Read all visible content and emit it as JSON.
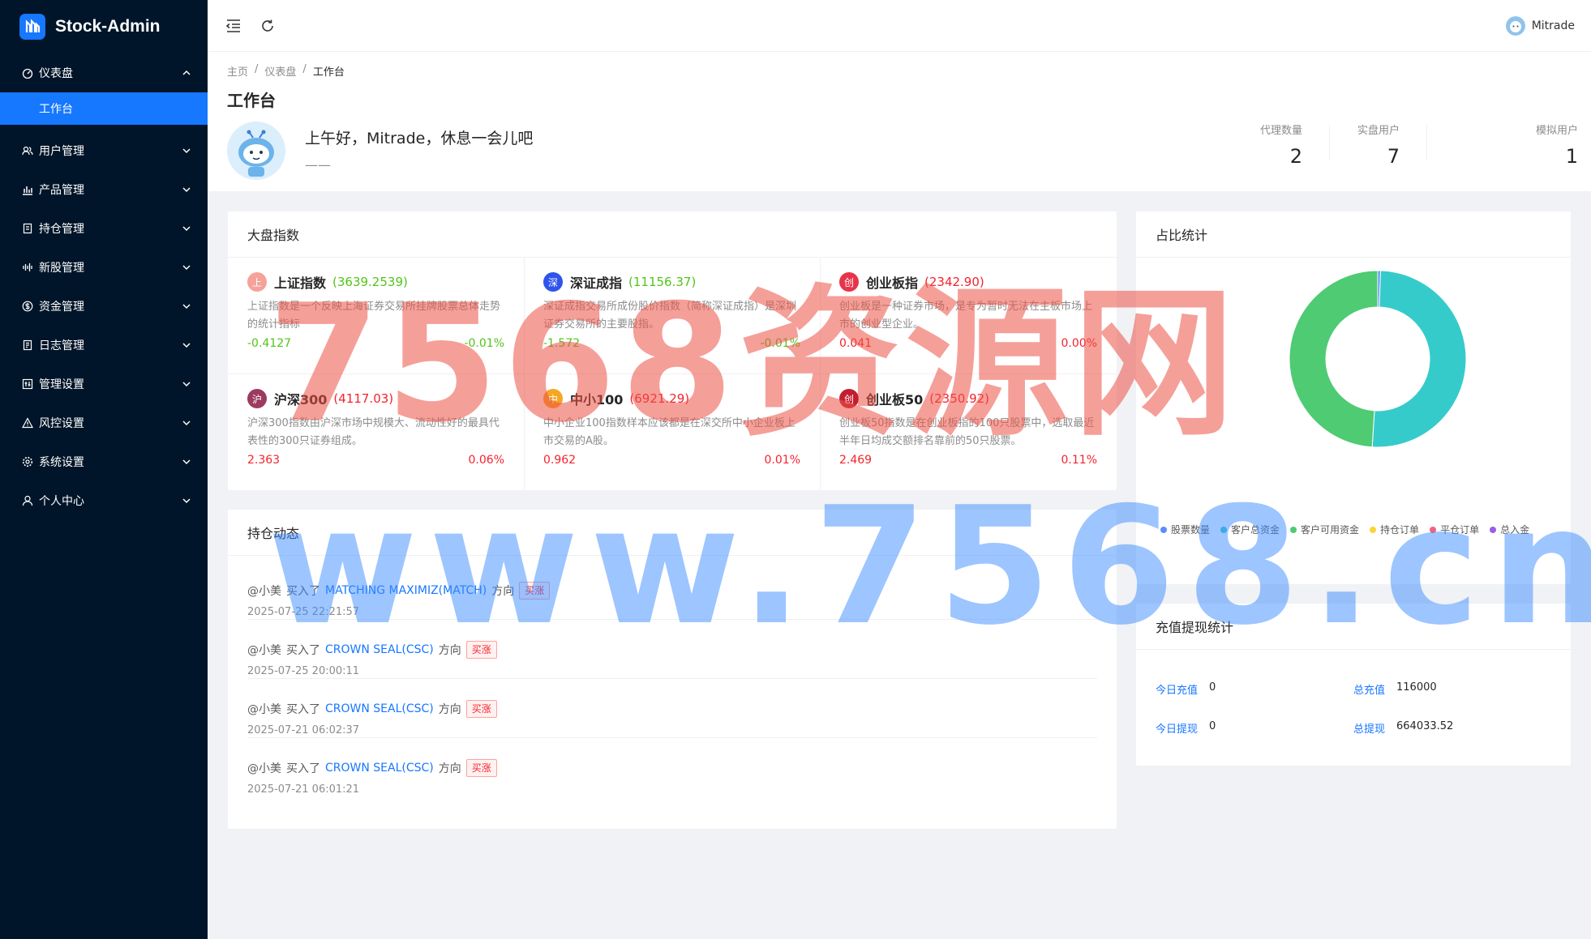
{
  "app": {
    "name": "Stock-Admin"
  },
  "sidebar": {
    "items": [
      {
        "label": "仪表盘",
        "icon": "dashboard-icon",
        "open": true
      },
      {
        "label": "用户管理",
        "icon": "users-icon"
      },
      {
        "label": "产品管理",
        "icon": "bar-chart-icon"
      },
      {
        "label": "持仓管理",
        "icon": "clipboard-icon"
      },
      {
        "label": "新股管理",
        "icon": "audio-icon"
      },
      {
        "label": "资金管理",
        "icon": "dollar-icon"
      },
      {
        "label": "日志管理",
        "icon": "log-icon"
      },
      {
        "label": "管理设置",
        "icon": "setting-panel-icon"
      },
      {
        "label": "风控设置",
        "icon": "warning-icon"
      },
      {
        "label": "系统设置",
        "icon": "gear-icon"
      },
      {
        "label": "个人中心",
        "icon": "user-icon"
      }
    ],
    "sub_active": "工作台"
  },
  "header": {
    "username": "Mitrade"
  },
  "breadcrumb": [
    "主页",
    "/",
    "仪表盘",
    "/",
    "工作台"
  ],
  "page": {
    "title": "工作台",
    "greeting": "上午好，Mitrade，休息一会儿吧",
    "greeting_sub": "——",
    "stats": [
      {
        "label": "代理数量",
        "value": "2"
      },
      {
        "label": "实盘用户",
        "value": "7"
      },
      {
        "label": "模拟用户",
        "value": "1"
      }
    ]
  },
  "market": {
    "title": "大盘指数",
    "indices": [
      {
        "badge": "上",
        "badge_color": "#f4a29a",
        "name": "上证指数",
        "price": "(3639.2539)",
        "trend": "down",
        "desc": "上证指数是一个反映上海证券交易所挂牌股票总体走势的统计指标",
        "change": "-0.4127",
        "pct": "-0.01%"
      },
      {
        "badge": "深",
        "badge_color": "#2f54eb",
        "name": "深证成指",
        "price": "(11156.37)",
        "trend": "down",
        "desc": "深证成指交易所成份股价指数（简称深证成指）是深圳证券交易所的主要股指。",
        "change": "-1.572",
        "pct": "-0.01%"
      },
      {
        "badge": "创",
        "badge_color": "#e8344a",
        "name": "创业板指",
        "price": "(2342.90)",
        "trend": "up",
        "desc": "创业板是一种证券市场，是专为暂时无法在主板市场上市的创业型企业。",
        "change": "0.041",
        "pct": "0.00%"
      },
      {
        "badge": "沪",
        "badge_color": "#9c3b5f",
        "name": "沪深300",
        "price": "(4117.03)",
        "trend": "up",
        "desc": "沪深300指数由沪深市场中规模大、流动性好的最具代表性的300只证券组成。",
        "change": "2.363",
        "pct": "0.06%"
      },
      {
        "badge": "中",
        "badge_color": "#f6a623",
        "name": "中小100",
        "price": "(6921.29)",
        "trend": "up",
        "desc": "中小企业100指数样本应该都是在深交所中小企业板上市交易的A股。",
        "change": "0.962",
        "pct": "0.01%"
      },
      {
        "badge": "创",
        "badge_color": "#c41d2f",
        "name": "创业板50",
        "price": "(2350.92)",
        "trend": "up",
        "desc": "创业板50指数是在创业板指的100只股票中，选取最近半年日均成交额排名靠前的50只股票。",
        "change": "2.469",
        "pct": "0.11%"
      }
    ]
  },
  "holdings": {
    "title": "持仓动态",
    "items": [
      {
        "user": "@小美",
        "action": "买入了",
        "stock": "MATCHING MAXIMIZ(MATCH)",
        "dir": "方向",
        "tag": "买涨",
        "time": "2025-07-25 22:21:57"
      },
      {
        "user": "@小美",
        "action": "买入了",
        "stock": "CROWN SEAL(CSC)",
        "dir": "方向",
        "tag": "买涨",
        "time": "2025-07-25 20:00:11"
      },
      {
        "user": "@小美",
        "action": "买入了",
        "stock": "CROWN SEAL(CSC)",
        "dir": "方向",
        "tag": "买涨",
        "time": "2025-07-21 06:02:37"
      },
      {
        "user": "@小美",
        "action": "买入了",
        "stock": "CROWN SEAL(CSC)",
        "dir": "方向",
        "tag": "买涨",
        "time": "2025-07-21 06:01:21"
      }
    ]
  },
  "ratio": {
    "title": "占比统计",
    "chart_data": {
      "type": "pie",
      "categories": [
        "股票数量",
        "客户总资金",
        "客户可用资金",
        "持仓订单",
        "平仓订单",
        "总入金"
      ],
      "values": [
        0.5,
        50.5,
        49.0,
        0.0,
        0.0,
        0.0
      ],
      "colors": [
        "#5b8ff9",
        "#36cbcb",
        "#4ecb73",
        "#fbd437",
        "#f2637b",
        "#975fe5"
      ]
    }
  },
  "recharge": {
    "title": "充值提现统计",
    "today_recharge_label": "今日充值",
    "today_recharge": "0",
    "total_recharge_label": "总充值",
    "total_recharge": "116000",
    "today_withdraw_label": "今日提现",
    "today_withdraw": "0",
    "total_withdraw_label": "总提现",
    "total_withdraw": "664033.52"
  },
  "watermark": {
    "line1": "7568资源网",
    "line2": "www.7568.cn"
  }
}
